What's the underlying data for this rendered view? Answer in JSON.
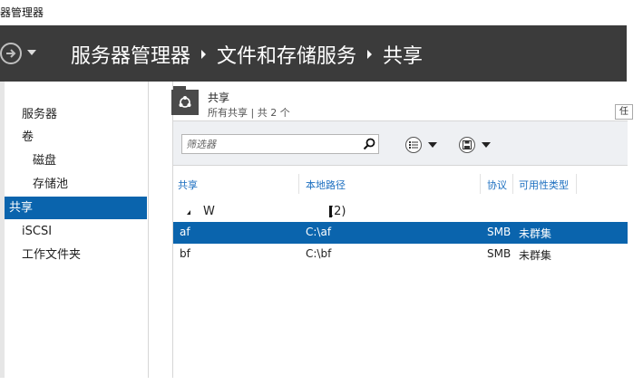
{
  "window": {
    "title": "器管理器"
  },
  "header": {
    "breadcrumbs": [
      "服务器管理器",
      "文件和存储服务",
      "共享"
    ]
  },
  "sidebar": {
    "items": [
      {
        "label": "服务器",
        "level": 0,
        "active": false
      },
      {
        "label": "卷",
        "level": 0,
        "active": false
      },
      {
        "label": "磁盘",
        "level": 1,
        "active": false
      },
      {
        "label": "存储池",
        "level": 1,
        "active": false
      },
      {
        "label": "共享",
        "level": 0,
        "active": true
      },
      {
        "label": "iSCSI",
        "level": 0,
        "active": false
      },
      {
        "label": "工作文件夹",
        "level": 0,
        "active": false
      }
    ]
  },
  "tile": {
    "title": "共享",
    "subtitle": "所有共享 | 共 2 个",
    "tasks_label": "任"
  },
  "filter": {
    "placeholder": "筛选器"
  },
  "table": {
    "columns": [
      "共享",
      "本地路径",
      "协议",
      "可用性类型"
    ],
    "group": {
      "name": "W",
      "count": "(2)"
    },
    "rows": [
      {
        "share": "af",
        "path": "C:\\af",
        "protocol": "SMB",
        "availability": "未群集",
        "selected": true
      },
      {
        "share": "bf",
        "path": "C:\\bf",
        "protocol": "SMB",
        "availability": "未群集",
        "selected": false
      }
    ]
  },
  "colors": {
    "header_bg": "#3b3b3b",
    "accent": "#0a64ad",
    "column_header": "#1c6fc0"
  }
}
